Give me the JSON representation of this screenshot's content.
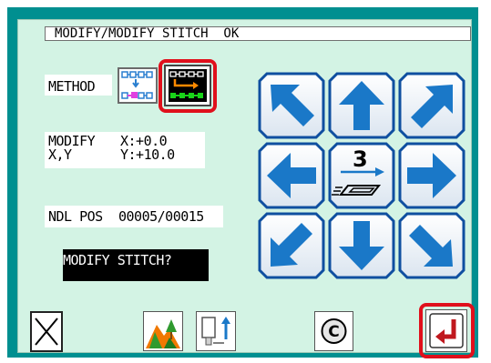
{
  "title": "MODIFY/MODIFY STITCH  OK",
  "method": {
    "label": "METHOD"
  },
  "modify": {
    "label_line1": "MODIFY",
    "label_line2": "X,Y",
    "x_value": "X:+0.0",
    "y_value": "Y:+10.0"
  },
  "needle_pos": {
    "label": "NDL POS",
    "value": "00005/00015"
  },
  "message": "MODIFY STITCH?",
  "step": {
    "value": "3"
  },
  "colors": {
    "frame": "#008f90",
    "panel": "#d3f3e4",
    "arrow": "#1a78c8",
    "accent_red": "#e0101c"
  },
  "icons": {
    "arrows": [
      "arrow-up-left-icon",
      "arrow-up-icon",
      "arrow-up-right-icon",
      "arrow-left-icon",
      "step-feed-icon",
      "arrow-right-icon",
      "arrow-down-left-icon",
      "arrow-down-icon",
      "arrow-down-right-icon"
    ],
    "bottom": [
      "close-icon",
      "landscape-icon",
      "needle-up-icon",
      "clear-c-icon",
      "enter-return-icon"
    ]
  }
}
